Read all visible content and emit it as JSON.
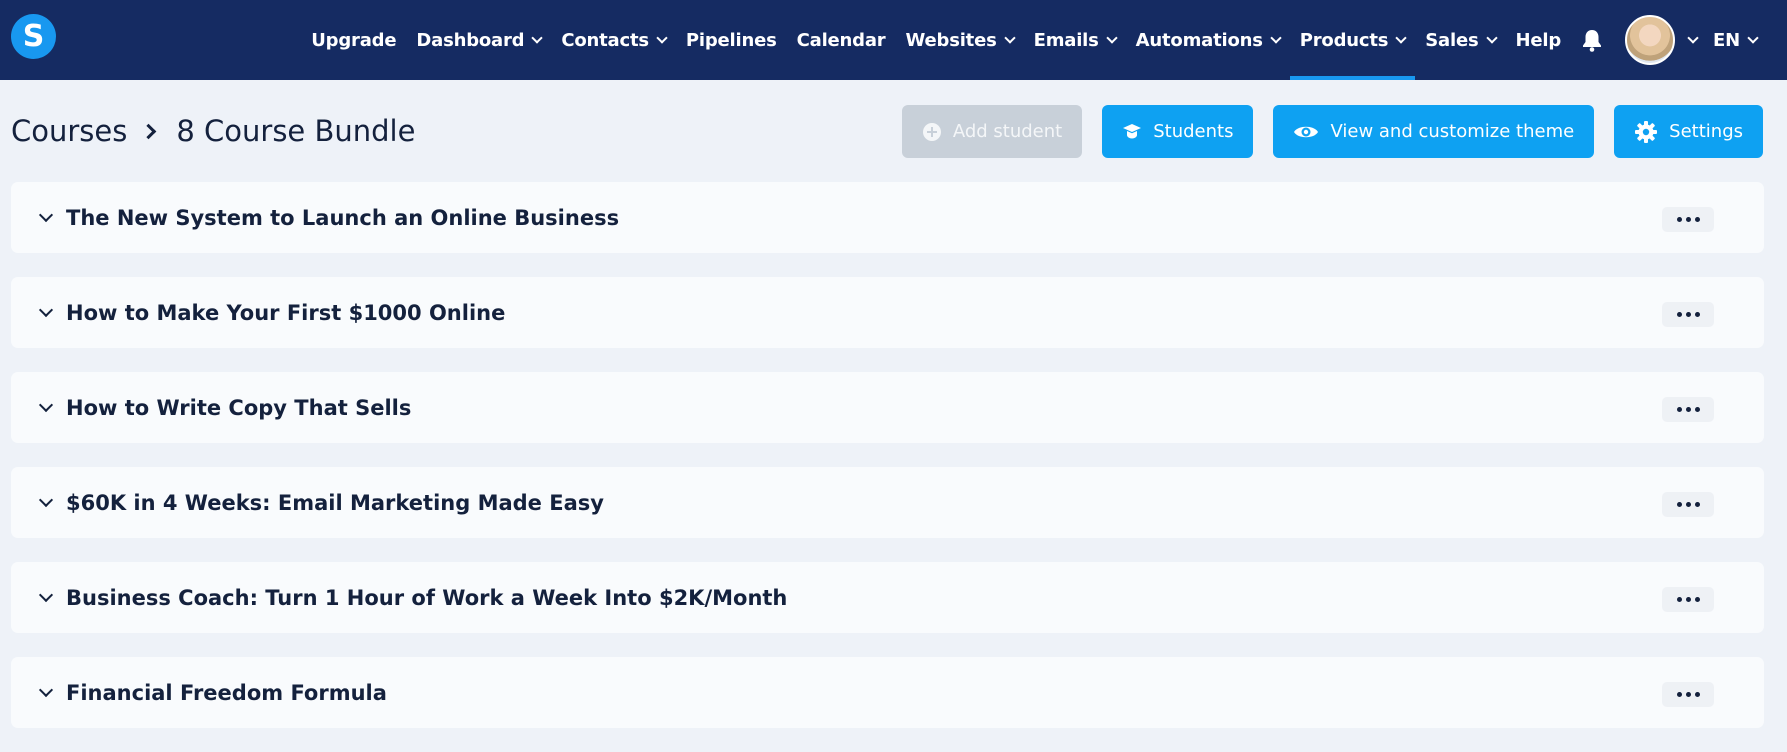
{
  "brand": {
    "logo_letter": "S",
    "accent": "#1898f0",
    "nav_bg": "#152b62"
  },
  "nav": {
    "items": [
      {
        "label": "Upgrade",
        "dropdown": false,
        "active": false
      },
      {
        "label": "Dashboard",
        "dropdown": true,
        "active": false
      },
      {
        "label": "Contacts",
        "dropdown": true,
        "active": false
      },
      {
        "label": "Pipelines",
        "dropdown": false,
        "active": false
      },
      {
        "label": "Calendar",
        "dropdown": false,
        "active": false
      },
      {
        "label": "Websites",
        "dropdown": true,
        "active": false
      },
      {
        "label": "Emails",
        "dropdown": true,
        "active": false
      },
      {
        "label": "Automations",
        "dropdown": true,
        "active": false
      },
      {
        "label": "Products",
        "dropdown": true,
        "active": true
      },
      {
        "label": "Sales",
        "dropdown": true,
        "active": false
      },
      {
        "label": "Help",
        "dropdown": false,
        "active": false
      }
    ],
    "language": "EN"
  },
  "breadcrumb": {
    "parent": "Courses",
    "current": "8 Course Bundle"
  },
  "actions": {
    "add_student": "Add student",
    "students": "Students",
    "view_theme": "View and customize theme",
    "settings": "Settings"
  },
  "courses": [
    "The New System to Launch an Online Business",
    "How to Make Your First $1000 Online",
    "How to Write Copy That Sells",
    "$60K in 4 Weeks: Email Marketing Made Easy",
    "Business Coach: Turn 1 Hour of Work a Week Into $2K/Month",
    "Financial Freedom Formula"
  ]
}
